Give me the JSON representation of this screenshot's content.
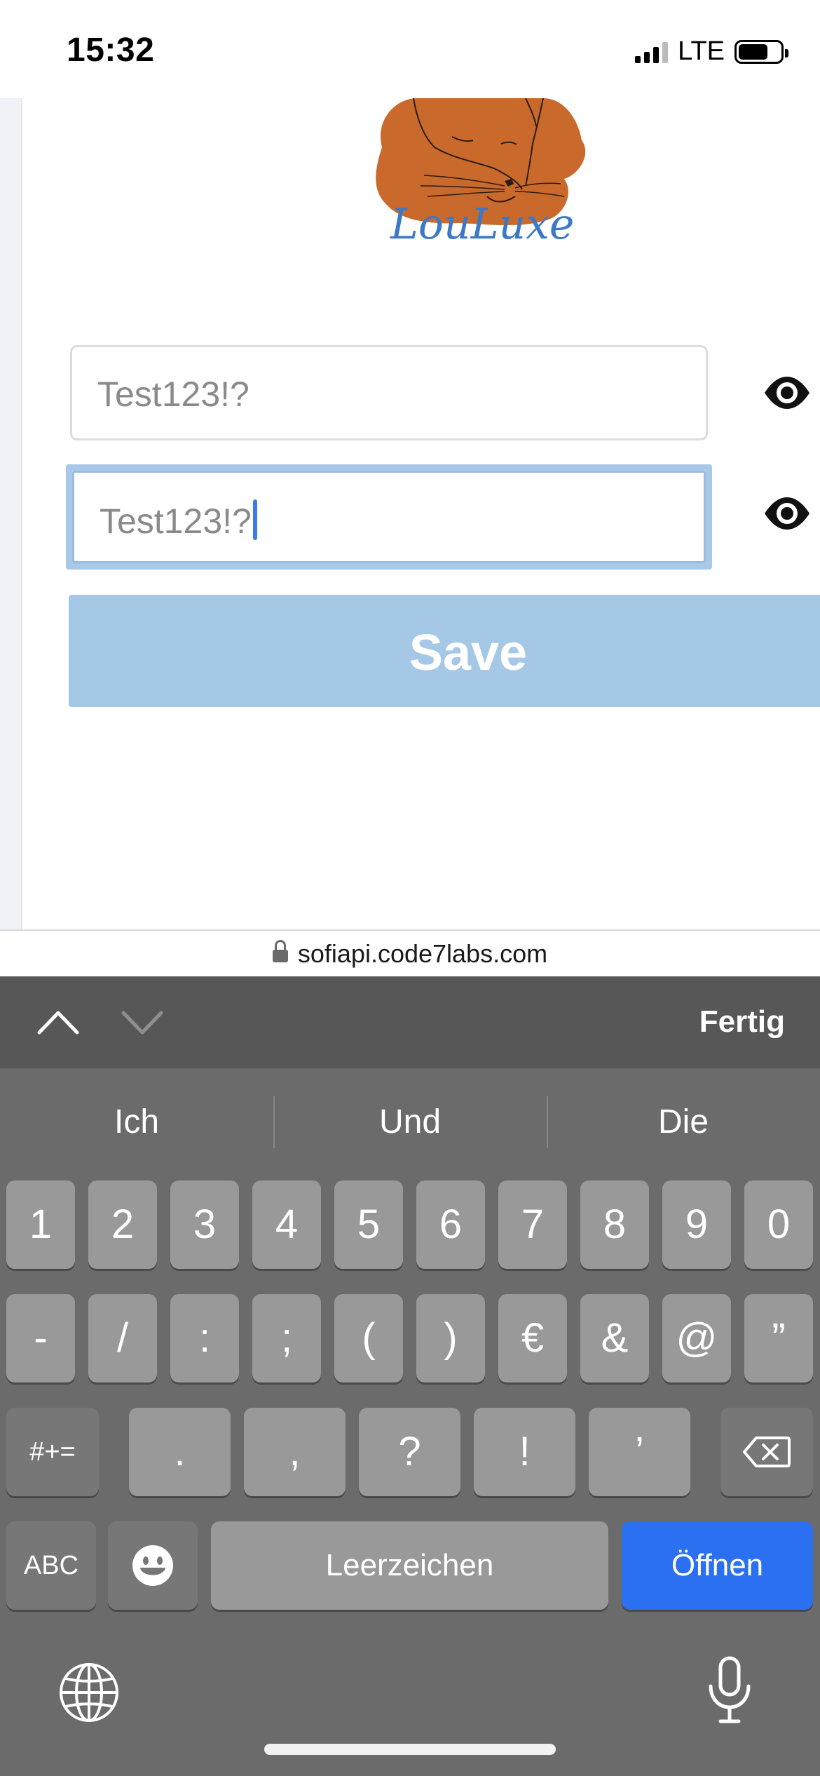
{
  "status_bar": {
    "time": "15:32",
    "network": "LTE"
  },
  "page": {
    "logo_text": "LouLuxe",
    "password_field": {
      "value": "Test123!?",
      "show_icon": "eye-icon"
    },
    "confirm_field": {
      "value": "Test123!?",
      "show_icon": "eye-icon"
    },
    "save_label": "Save",
    "colors": {
      "save_button": "#a6c8e7",
      "focus_ring": "#a8c8e8",
      "logo_orange": "#c96a2c",
      "logo_text": "#3a78c8"
    }
  },
  "url_bar": {
    "domain": "sofiapi.code7labs.com"
  },
  "keyboard_toolbar": {
    "done_label": "Fertig"
  },
  "keyboard": {
    "suggestions": [
      "Ich",
      "Und",
      "Die"
    ],
    "row1": [
      "1",
      "2",
      "3",
      "4",
      "5",
      "6",
      "7",
      "8",
      "9",
      "0"
    ],
    "row2": [
      "-",
      "/",
      ":",
      ";",
      "(",
      ")",
      "€",
      "&",
      "@",
      "”"
    ],
    "row3_mode": "#+=",
    "row3": [
      ".",
      ",",
      "?",
      "!",
      "’"
    ],
    "abc_label": "ABC",
    "space_label": "Leerzeichen",
    "return_label": "Öffnen",
    "return_color": "#2b70f0"
  }
}
